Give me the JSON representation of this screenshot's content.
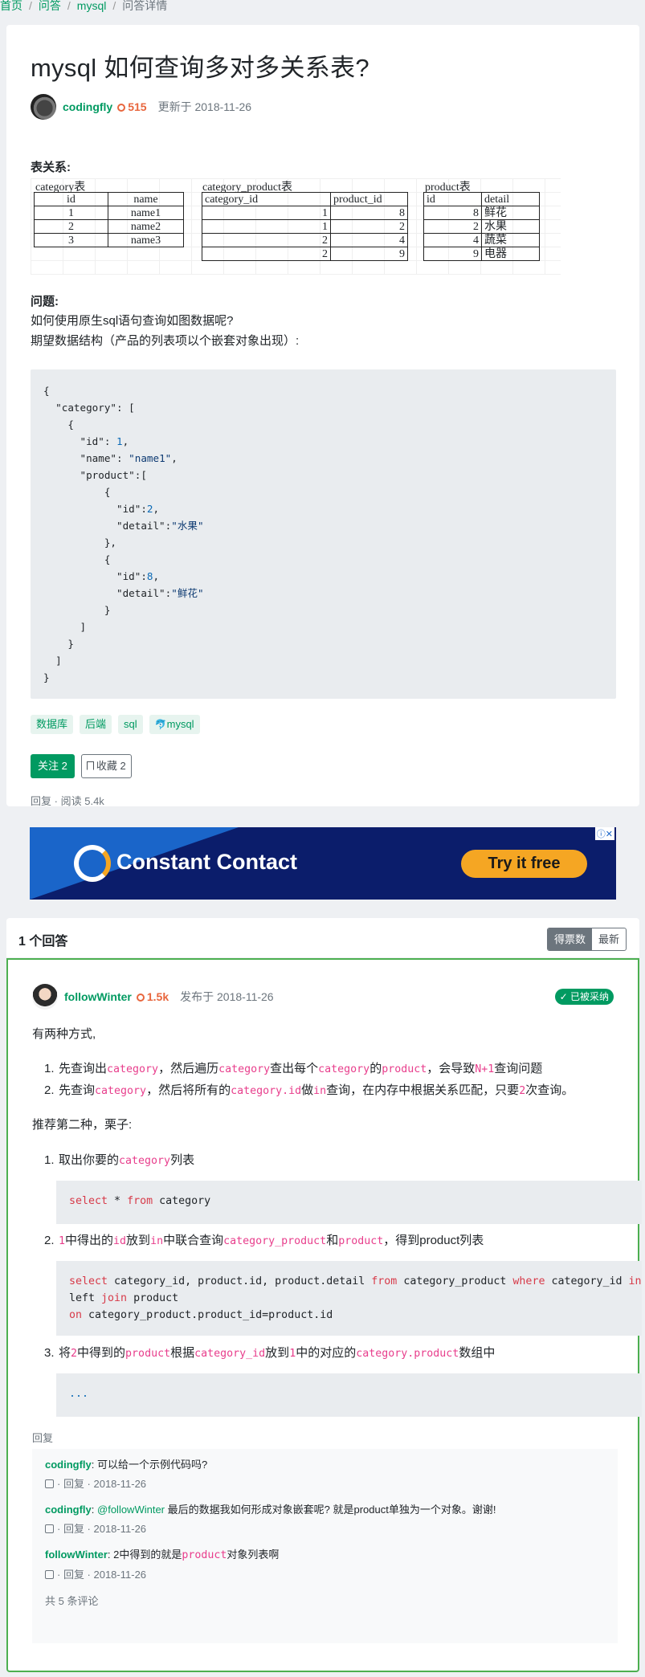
{
  "breadcrumb": {
    "home": "首页",
    "qa": "问答",
    "tag": "mysql",
    "current": "问答详情"
  },
  "question": {
    "title": "mysql 如何查询多对多关系表?",
    "author": "codingfly",
    "reputation": "515",
    "updated": "更新于 2018-11-26",
    "relations_label": "表关系:",
    "problem_label": "问题:",
    "line1": "如何使用原生sql语句查询如图数据呢?",
    "line2": "期望数据结构（产品的列表项以个嵌套对象出现）:",
    "tags": [
      "数据库",
      "后端",
      "sql",
      "mysql"
    ],
    "follow_label": "关注 2",
    "fav_label": "收藏 2",
    "foot_reply": "回复",
    "foot_sep": "·",
    "foot_views": "阅读 5.4k"
  },
  "tables": {
    "category": {
      "title": "category表",
      "headers": [
        "id",
        "name"
      ],
      "rows": [
        [
          "1",
          "name1"
        ],
        [
          "2",
          "name2"
        ],
        [
          "3",
          "name3"
        ]
      ]
    },
    "category_product": {
      "title": "category_product表",
      "headers": [
        "category_id",
        "product_id"
      ],
      "rows": [
        [
          "1",
          "8"
        ],
        [
          "1",
          "2"
        ],
        [
          "2",
          "4"
        ],
        [
          "2",
          "9"
        ]
      ]
    },
    "product": {
      "title": "product表",
      "headers": [
        "id",
        "detail"
      ],
      "rows": [
        [
          "8",
          "鲜花"
        ],
        [
          "2",
          "水果"
        ],
        [
          "4",
          "蔬菜"
        ],
        [
          "9",
          "电器"
        ]
      ]
    }
  },
  "ad": {
    "brand": "Constant Contact",
    "cta": "Try it free",
    "badge": "ⓘ✕"
  },
  "answers_header": {
    "count": "1 个回答",
    "sort_votes": "得票数",
    "sort_new": "最新"
  },
  "answer": {
    "author": "followWinter",
    "reputation": "1.5k",
    "published": "发布于 2018-11-26",
    "accepted": "✓ 已被采纳",
    "intro": "有两种方式,",
    "recommend": "推荐第二种，栗子:",
    "reply": "回复"
  },
  "comments": [
    {
      "user": "codingfly",
      "text": "可以给一个示例代码吗?",
      "meta": "· 回复 · 2018-11-26"
    },
    {
      "user": "codingfly",
      "mention": "@followWinter",
      "text": " 最后的数据我如何形成对象嵌套呢? 就是product单独为一个对象。谢谢!",
      "meta": "· 回复 · 2018-11-26"
    },
    {
      "user": "followWinter",
      "text_pre": "2中得到的就是",
      "code": "product",
      "text_post": "对象列表啊",
      "meta": "· 回复 · 2018-11-26"
    }
  ],
  "comments_total": "共 5 条评论"
}
